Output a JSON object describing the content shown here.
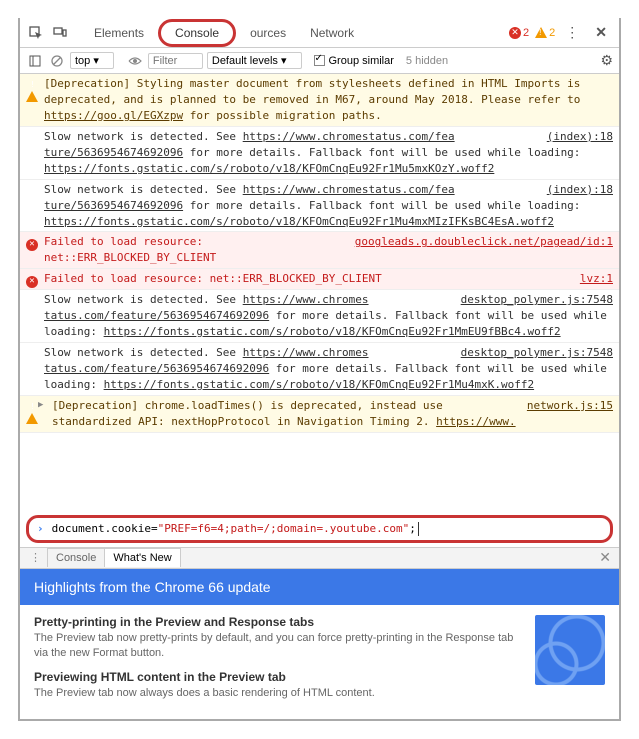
{
  "tabs": {
    "elements": "Elements",
    "console": "Console",
    "sources": "ources",
    "network": "Network"
  },
  "status": {
    "errors": "2",
    "warnings": "2",
    "hidden": "5 hidden"
  },
  "filter": {
    "context": "top",
    "placeholder": "Filter",
    "levels": "Default levels",
    "group_similar": "Group similar"
  },
  "messages": [
    {
      "type": "warn",
      "text_parts": [
        "[Deprecation] Styling master document from stylesheets defined in HTML Imports is deprecated, and is planned to be removed in M67, around May 2018. Please refer to ",
        {
          "link": "https://goo.gl/EGXzpw"
        },
        " for possible migration paths."
      ]
    },
    {
      "type": "info",
      "text_parts": [
        "Slow network is detected. See ",
        {
          "link": "https://www.chromestatus.com/fea"
        },
        "  ",
        {
          "link_right": "(index):18"
        },
        {
          "link": "ture/5636954674692096"
        },
        " for more details. Fallback font will be used while loading: ",
        {
          "link": "https://fonts.gstatic.com/s/roboto/v18/KFOmCnqEu92Fr1Mu5mxKOzY.woff2"
        }
      ]
    },
    {
      "type": "info",
      "text_parts": [
        "Slow network is detected. See ",
        {
          "link": "https://www.chromestatus.com/fea"
        },
        "  ",
        {
          "link_right": "(index):18"
        },
        {
          "link": "ture/5636954674692096"
        },
        " for more details. Fallback font will be used while loading: ",
        {
          "link": "https://fonts.gstatic.com/s/roboto/v18/KFOmCnqEu92Fr1Mu4mxMIzIFKsBC4EsA.woff2"
        }
      ]
    },
    {
      "type": "err",
      "text_parts": [
        "Failed to load resource: net::ERR_BLOCKED_BY_CLIENT"
      ],
      "right": "googleads.g.doubleclick.net/pagead/id:1"
    },
    {
      "type": "err",
      "text_parts": [
        "Failed to load resource: net::ERR_BLOCKED_BY_CLIENT"
      ],
      "right": "lvz:1"
    },
    {
      "type": "info",
      "text_parts": [
        "Slow network is detected. See ",
        {
          "link": "https://www.chromes"
        },
        "  ",
        {
          "link_right": "desktop_polymer.js:7548"
        },
        {
          "link": "tatus.com/feature/5636954674692096"
        },
        " for more details. Fallback font will be used while loading: ",
        {
          "link": "https://fonts.gstatic.com/s/roboto/v18/KFOmCnqEu92Fr1MmEU9fBBc4.woff2"
        }
      ]
    },
    {
      "type": "info",
      "text_parts": [
        "Slow network is detected. See ",
        {
          "link": "https://www.chromes"
        },
        "  ",
        {
          "link_right": "desktop_polymer.js:7548"
        },
        {
          "link": "tatus.com/feature/5636954674692096"
        },
        " for more details. Fallback font will be used while loading: ",
        {
          "link": "https://fonts.gstatic.com/s/roboto/v18/KFOmCnqEu92Fr1Mu4mxK.woff2"
        }
      ]
    },
    {
      "type": "warn",
      "disclosure": true,
      "text_parts": [
        "[Deprecation] chrome.loadTimes() is deprecated, instead use standardized API: nextHopProtocol in Navigation Timing 2. ",
        {
          "link": "https://www."
        }
      ],
      "right": "network.js:15"
    }
  ],
  "prompt": {
    "pre": "document.cookie=",
    "str": "\"PREF=f6=4;path=/;domain=.youtube.com\"",
    "post": ";"
  },
  "drawer": {
    "console": "Console",
    "whatsnew": "What's New"
  },
  "highlights": {
    "title": "Highlights from the Chrome 66 update"
  },
  "whatsnew": {
    "h1": "Pretty-printing in the Preview and Response tabs",
    "p1": "The Preview tab now pretty-prints by default, and you can force pretty-printing in the Response tab via the new Format button.",
    "h2": "Previewing HTML content in the Preview tab",
    "p2": "The Preview tab now always does a basic rendering of HTML content."
  }
}
